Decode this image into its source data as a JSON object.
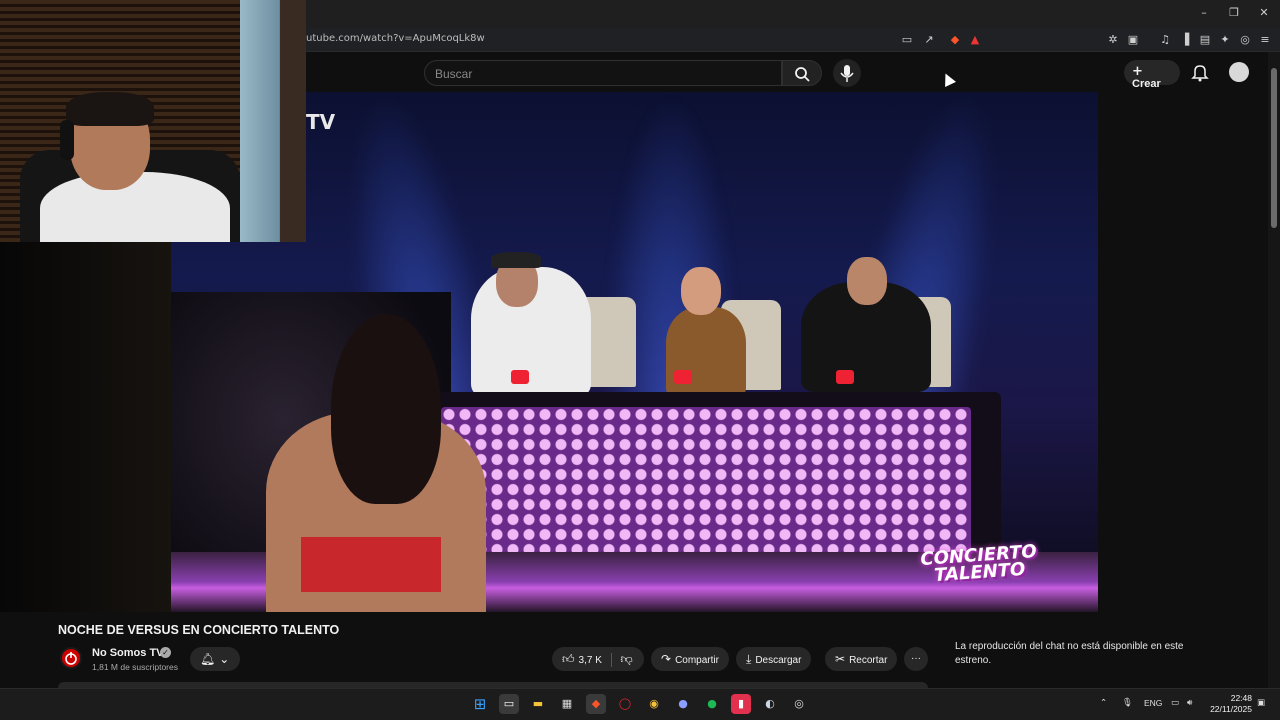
{
  "browser": {
    "url": "utube.com/watch?v=ApuMcoqLk8w",
    "window_controls": {
      "minimize": "–",
      "maximize": "❐",
      "close": "✕"
    }
  },
  "youtube": {
    "search_placeholder": "Buscar",
    "create_label": "Crear",
    "channel_overlay": "TV"
  },
  "video": {
    "show_logo_line1": "CONCIERTO",
    "show_logo_line2": "TALENTO"
  },
  "details": {
    "title": "NOCHE DE VERSUS EN CONCIERTO TALENTO",
    "channel_name": "No Somos TV",
    "subscribers": "1,81 M de suscriptores",
    "likes": "3,7 K",
    "share_label": "Compartir",
    "download_label": "Descargar",
    "clip_label": "Recortar",
    "more_label": "···"
  },
  "chat": {
    "message": "La reproducción del chat no está disponible en este estreno."
  },
  "taskbar": {
    "lang": "ENG",
    "time": "22:48",
    "date": "22/11/2025",
    "icons": [
      "windows-start-icon",
      "task-view-icon",
      "file-explorer-icon",
      "store-icon",
      "brave-icon",
      "opera-icon",
      "chrome-icon",
      "discord-icon",
      "spotify-icon",
      "app-icon",
      "steam-icon",
      "obs-icon"
    ]
  },
  "colors": {
    "accent_red": "#cc0000",
    "background": "#0f0f0f",
    "pill": "#272727"
  }
}
